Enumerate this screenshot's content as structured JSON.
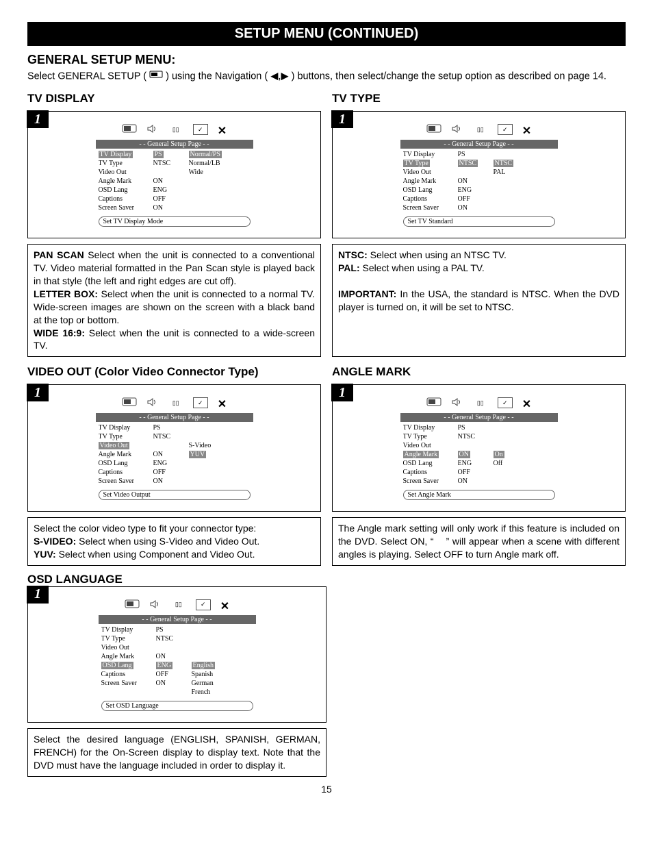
{
  "title": "SETUP MENU (CONTINUED)",
  "general_heading": "GENERAL SETUP MENU:",
  "intro_a": "Select GENERAL SETUP (",
  "intro_b": ") using the Navigation (",
  "intro_c": ") buttons, then select/change the setup option as described on page 14.",
  "step": "1",
  "pagenum": "15",
  "osd_header": "- - General Setup Page - -",
  "rows_labels": [
    "TV Display",
    "TV Type",
    "Video Out",
    "Angle Mark",
    "OSD Lang",
    "Captions",
    "Screen Saver"
  ],
  "rows_defaults": [
    "PS",
    "NTSC",
    "",
    "ON",
    "ENG",
    "OFF",
    "ON"
  ],
  "cards": {
    "tvdisplay": {
      "head": "TV DISPLAY",
      "hi_row": 0,
      "opts": [
        "Normal/PS",
        "Normal/LB",
        "Wide",
        "",
        "",
        "",
        ""
      ],
      "hi_opt_row": 0,
      "foot": "Set TV Display Mode",
      "desc": "<b>PAN SCAN</b> Select when the unit is connected to a conventional TV. Video material formatted in the Pan Scan style is played back in that style (the left and right edges are cut off).<br><b>LETTER BOX:</b> Select when the unit is connected to a normal TV. Wide-screen images are shown on the screen with a black band at the top or bottom.<br><b>WIDE 16:9:</b> Select when the unit is connected to a wide-screen TV."
    },
    "tvtype": {
      "head": "TV TYPE",
      "hi_row": 1,
      "opts": [
        "",
        "NTSC",
        "PAL",
        "",
        "",
        "",
        ""
      ],
      "hi_opt_row": 1,
      "foot": "Set TV Standard",
      "desc": "<b>NTSC:</b> Select when using an NTSC TV.<br><b>PAL:</b> Select when using a PAL TV.<br><br><b>IMPORTANT:</b> In the USA, the standard is NTSC. When the DVD player is turned on, it will be set to NTSC."
    },
    "videoout": {
      "head": "VIDEO OUT (Color Video Connector Type)",
      "hi_row": 2,
      "opts": [
        "",
        "",
        "S-Video",
        "YUV",
        "",
        "",
        ""
      ],
      "hi_opt_row": 3,
      "foot": "Set Video Output",
      "desc": "Select the color video type to fit your connector type:<br><b>S-VIDEO:</b>  Select when using S-Video and Video Out.<br><b>YUV:</b> Select when using Component and Video Out."
    },
    "anglemark": {
      "head": "ANGLE MARK",
      "hi_row": 3,
      "opts": [
        "",
        "",
        "",
        "On",
        "Off",
        "",
        ""
      ],
      "hi_opt_row": 3,
      "foot": "Set Angle Mark",
      "desc": "The Angle mark setting will only work if this feature is included on the DVD. Select ON, “    ” will appear when a scene with different angles is playing. Select OFF to turn Angle mark off."
    },
    "osdlang": {
      "head": "OSD LANGUAGE",
      "hi_row": 4,
      "opts": [
        "",
        "",
        "",
        "",
        "English",
        "Spanish",
        "German",
        "French"
      ],
      "hi_opt_row": 4,
      "foot": "Set OSD Language",
      "desc": "Select the desired language (ENGLISH, SPANISH, GERMAN, FRENCH) for the On-Screen display to display text. Note that the DVD must have the language included in order to display it."
    }
  }
}
